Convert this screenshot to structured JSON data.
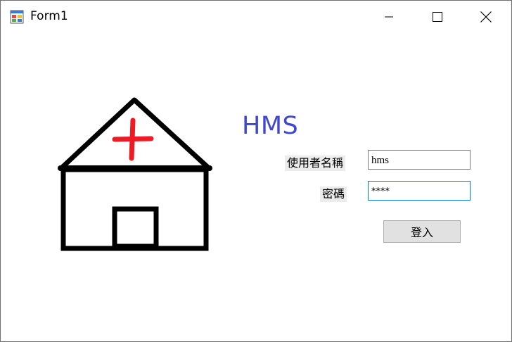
{
  "window": {
    "title": "Form1",
    "controls": {
      "minimize": "minimize",
      "maximize": "maximize",
      "close": "close"
    }
  },
  "form": {
    "heading": "HMS",
    "heading_color": "#3f48cc",
    "logo": {
      "icon": "hospital-house-icon",
      "cross_color": "#ed1c24"
    },
    "username": {
      "label": "使用者名稱",
      "value": "hms"
    },
    "password": {
      "label": "密碼",
      "value": "****"
    },
    "login_button": "登入"
  }
}
